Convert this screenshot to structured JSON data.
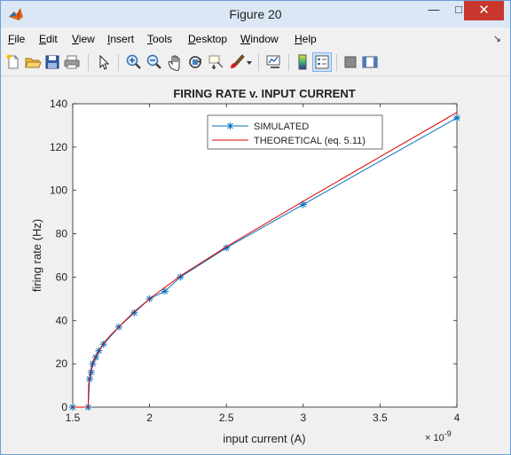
{
  "window": {
    "title": "Figure 20",
    "minimize_glyph": "—",
    "maximize_glyph": "□",
    "close_glyph": "✕",
    "icon": "matlab-icon"
  },
  "menubar": {
    "items": [
      {
        "underline": "F",
        "rest": "ile"
      },
      {
        "underline": "E",
        "rest": "dit"
      },
      {
        "underline": "V",
        "rest": "iew"
      },
      {
        "underline": "I",
        "rest": "nsert"
      },
      {
        "underline": "T",
        "rest": "ools"
      },
      {
        "underline": "D",
        "rest": "esktop"
      },
      {
        "underline": "W",
        "rest": "indow"
      },
      {
        "underline": "H",
        "rest": "elp"
      }
    ],
    "dock_arrow": "↘"
  },
  "toolbar": {
    "icons": [
      "new-figure-icon",
      "open-file-icon",
      "save-icon",
      "print-icon",
      "pointer-icon",
      "zoom-in-icon",
      "zoom-out-icon",
      "pan-icon",
      "rotate-3d-icon",
      "data-cursor-icon",
      "brush-icon",
      "brush-dropdown-icon",
      "link-plot-icon",
      "colorbar-icon",
      "legend-icon",
      "hide-plot-tools-icon",
      "show-plot-tools-icon"
    ]
  },
  "chart_data": {
    "type": "line",
    "title": "FIRING RATE v. INPUT CURRENT",
    "xlabel": "input current (A)",
    "ylabel": "firing rate (Hz)",
    "x_exponent": "× 10^-9",
    "xlim": [
      1.5,
      4.0
    ],
    "ylim": [
      0,
      140
    ],
    "xticks": [
      "1.5",
      "2",
      "2.5",
      "3",
      "3.5",
      "4"
    ],
    "yticks": [
      "0",
      "20",
      "40",
      "60",
      "80",
      "100",
      "120",
      "140"
    ],
    "legend_position": "top-right",
    "grid": false,
    "series": [
      {
        "name": "SIMULATED",
        "color": "#0072bd",
        "marker": "asterisk",
        "x": [
          1.5,
          1.6,
          1.61,
          1.62,
          1.63,
          1.65,
          1.67,
          1.7,
          1.8,
          1.9,
          2.0,
          2.1,
          2.2,
          2.5,
          3.0,
          4.0
        ],
        "y": [
          0,
          0,
          13,
          16,
          20,
          23,
          26,
          29,
          37,
          43.5,
          50,
          53.5,
          60,
          73.5,
          93.5,
          133.5
        ]
      },
      {
        "name": "THEORETICAL (eq. 5.11)",
        "color": "#e00000",
        "marker": "none",
        "x": [
          1.5,
          1.6,
          1.6,
          1.603,
          1.61,
          1.62,
          1.64,
          1.67,
          1.7,
          1.75,
          1.8,
          1.9,
          2.0,
          2.2,
          2.5,
          3.0,
          3.5,
          4.0
        ],
        "y": [
          0,
          0,
          0,
          10,
          14,
          18,
          22,
          26,
          29.5,
          33.5,
          37,
          44,
          50,
          60.5,
          74,
          95,
          115.5,
          136
        ]
      }
    ]
  }
}
